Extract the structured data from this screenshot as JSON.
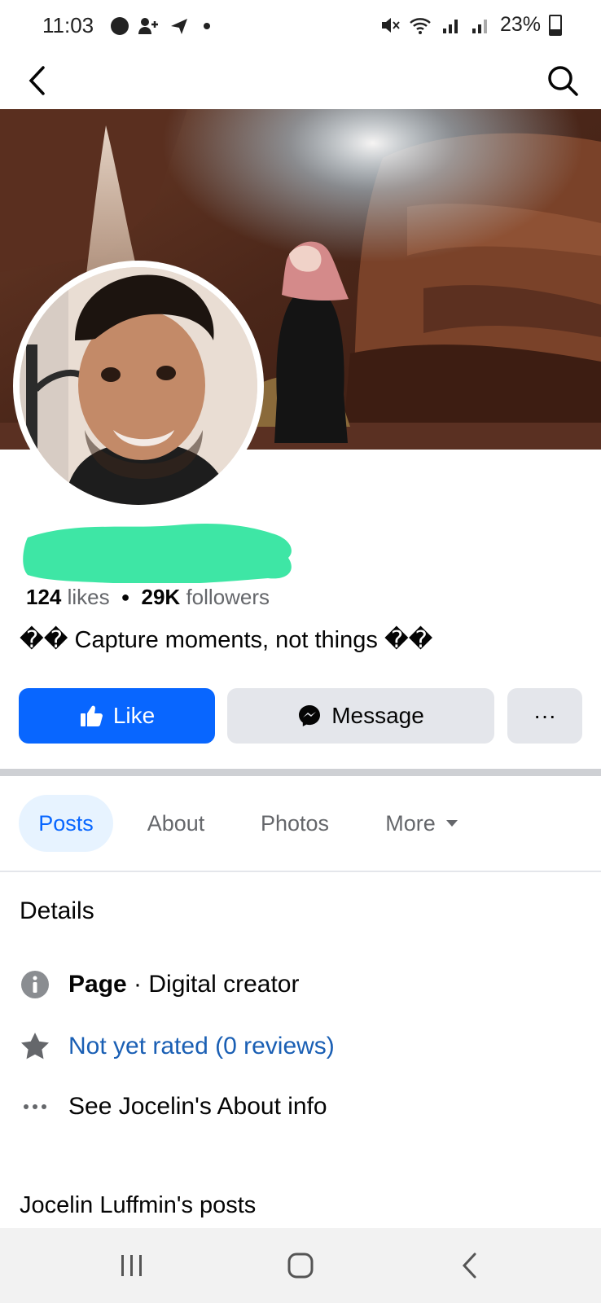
{
  "status_bar": {
    "time": "11:03",
    "battery": "23%"
  },
  "profile": {
    "likes_count": "124",
    "likes_label": "likes",
    "followers_count": "29K",
    "followers_label": "followers",
    "bio": "�� Capture moments, not things ��"
  },
  "actions": {
    "like": "Like",
    "message": "Message",
    "more": "···"
  },
  "tabs": [
    {
      "label": "Posts",
      "active": true
    },
    {
      "label": "About"
    },
    {
      "label": "Photos"
    },
    {
      "label": "More"
    }
  ],
  "details": {
    "title": "Details",
    "category_bold": "Page",
    "category_rest": " · Digital creator",
    "rating": "Not yet rated (0 reviews)",
    "about_link": "See Jocelin's About info"
  },
  "posts_section": {
    "title": "Jocelin Luffmin's posts"
  },
  "colors": {
    "brand_blue": "#0866ff",
    "link_blue": "#1a5fb4",
    "gray_button": "#e4e6eb",
    "redaction": "#3ee6a5"
  },
  "icons": [
    "back-arrow-icon",
    "search-icon",
    "thumbs-up-icon",
    "messenger-icon",
    "info-icon",
    "star-icon",
    "dots-icon"
  ]
}
